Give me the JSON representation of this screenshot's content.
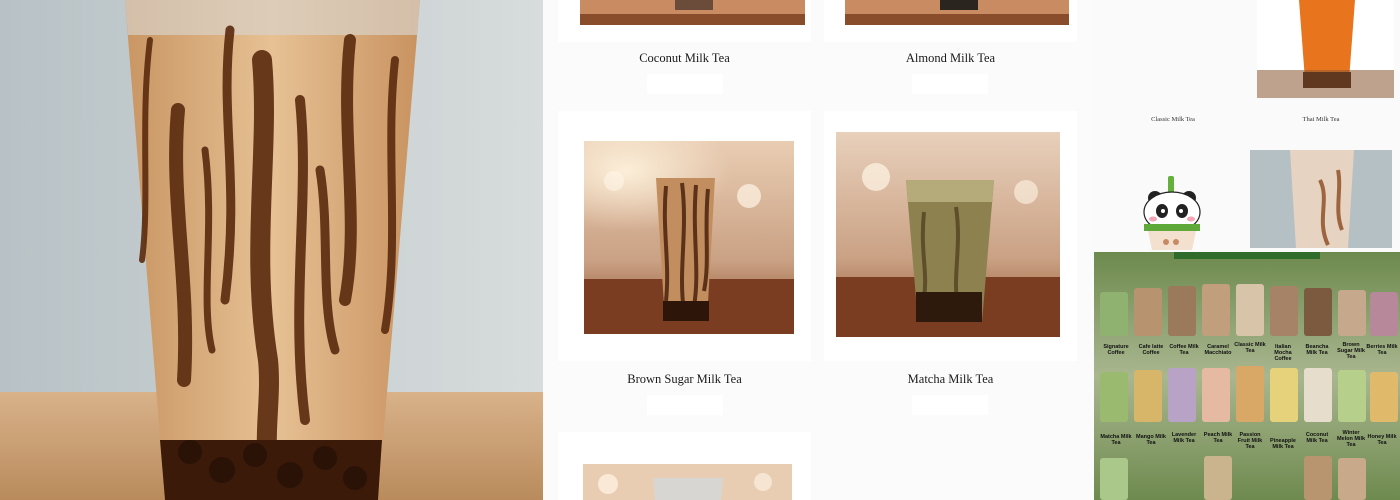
{
  "products": [
    {
      "name": "Coconut Milk Tea"
    },
    {
      "name": "Almond Milk Tea"
    },
    {
      "name": "Brown Sugar Milk Tea"
    },
    {
      "name": "Matcha Milk Tea"
    }
  ],
  "side_products": [
    {
      "name": "Classic Milk Tea"
    },
    {
      "name": "Thai Milk Tea"
    }
  ],
  "poster": {
    "row1": [
      "Signature Coffee",
      "Cafe latte Coffee",
      "Coffee Milk Tea",
      "Caramel Macchiato",
      "Classic Milk Tea",
      "Italian Mocha Coffee",
      "Beancha Milk Tea",
      "Brown Sugar Milk Tea",
      "Berries Milk Tea"
    ],
    "row2": [
      "Matcha Milk Tea",
      "Mango Milk Tea",
      "Lavender Milk Tea",
      "Peach Milk Tea",
      "Passion Fruit Milk Tea",
      "Pineapple Milk Tea",
      "Coconut Milk Tea",
      "Winter Melon Milk Tea",
      "Honey Milk Tea"
    ]
  },
  "colors": {
    "accent_green": "#5a8f3a",
    "brown_sugar": "#4a220d",
    "milk_tea": "#d6a777"
  }
}
